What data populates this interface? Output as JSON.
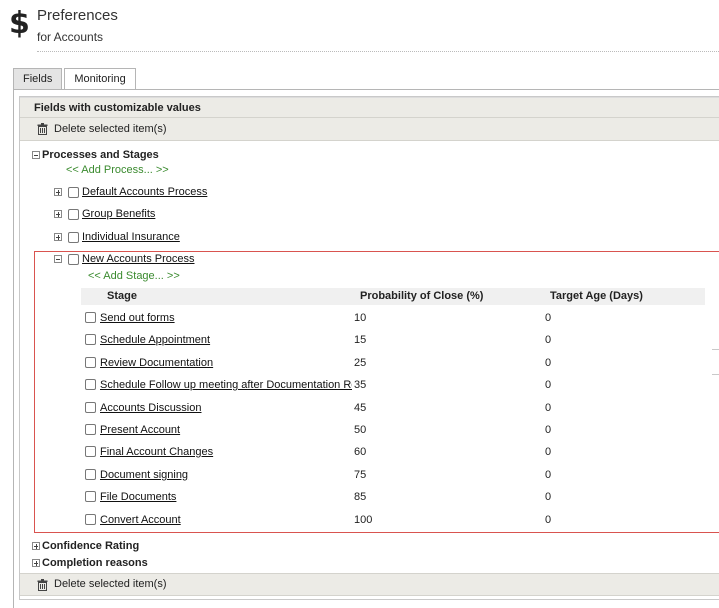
{
  "header": {
    "title": "Preferences",
    "subtitle": "for Accounts"
  },
  "tabs": [
    {
      "label": "Fields",
      "active": true
    },
    {
      "label": "Monitoring",
      "active": false
    }
  ],
  "section": {
    "title": "Fields with customizable values",
    "delete_label": "Delete selected item(s)"
  },
  "processes": {
    "title": "Processes and Stages",
    "add_process": "<< Add Process... >>",
    "items": [
      {
        "label": "Default Accounts Process",
        "expanded": false
      },
      {
        "label": "Group Benefits",
        "expanded": false
      },
      {
        "label": "Individual Insurance",
        "expanded": false
      },
      {
        "label": "New Accounts Process",
        "expanded": true
      }
    ],
    "add_stage": "<< Add Stage... >>",
    "stage_columns": {
      "stage": "Stage",
      "probability": "Probability of Close (%)",
      "age": "Target Age (Days)"
    },
    "stages": [
      {
        "name": "Send out forms",
        "probability": "10",
        "age": "0"
      },
      {
        "name": "Schedule Appointment",
        "probability": "15",
        "age": "0"
      },
      {
        "name": "Review Documentation",
        "probability": "25",
        "age": "0"
      },
      {
        "name": "Schedule Follow up meeting after Documentation Review",
        "probability": "35",
        "age": "0"
      },
      {
        "name": "Accounts Discussion",
        "probability": "45",
        "age": "0"
      },
      {
        "name": "Present Account",
        "probability": "50",
        "age": "0"
      },
      {
        "name": "Final Account Changes",
        "probability": "60",
        "age": "0"
      },
      {
        "name": "Document signing",
        "probability": "75",
        "age": "0"
      },
      {
        "name": "File Documents",
        "probability": "85",
        "age": "0"
      },
      {
        "name": "Convert Account",
        "probability": "100",
        "age": "0"
      }
    ]
  },
  "other_sections": [
    {
      "label": "Confidence Rating",
      "expanded": false
    },
    {
      "label": "Completion reasons",
      "expanded": false
    }
  ],
  "colors": {
    "accent_green": "#3a8a2e",
    "highlight_border": "#d9534f",
    "section_bar": "#ecebe6"
  }
}
